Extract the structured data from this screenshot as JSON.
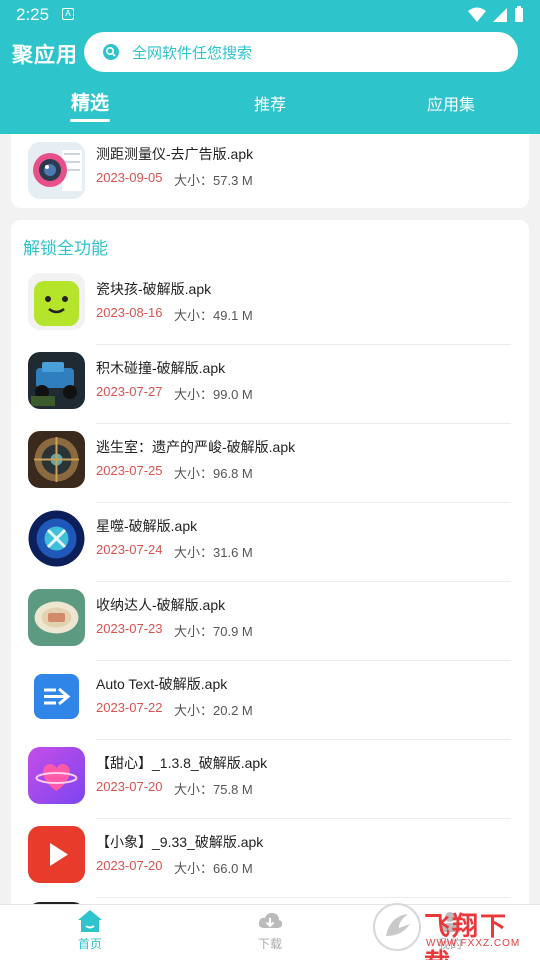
{
  "status_bar": {
    "time": "2:25",
    "sim_label": "A"
  },
  "header": {
    "app_title": "聚应用",
    "search_placeholder": "全网软件任您搜索",
    "tabs": [
      {
        "label": "精选",
        "active": true
      },
      {
        "label": "推荐",
        "active": false
      },
      {
        "label": "应用集",
        "active": false
      }
    ]
  },
  "prev_card": {
    "items": [
      {
        "name": "测距测量仪-去广告版.apk",
        "date": "2023-09-05",
        "size": "大小：57.3 M",
        "icon": "camera-lens-icon"
      }
    ]
  },
  "section": {
    "title": "解锁全功能",
    "items": [
      {
        "name": "瓷块孩-破解版.apk",
        "date": "2023-08-16",
        "size": "大小：49.1 M",
        "icon": "green-smiley-icon"
      },
      {
        "name": "积木碰撞-破解版.apk",
        "date": "2023-07-27",
        "size": "大小：99.0 M",
        "icon": "toy-car-icon"
      },
      {
        "name": "逃生室：遗产的严峻-破解版.apk",
        "date": "2023-07-25",
        "size": "大小：96.8 M",
        "icon": "vault-door-icon"
      },
      {
        "name": "星噬-破解版.apk",
        "date": "2023-07-24",
        "size": "大小：31.6 M",
        "icon": "galaxy-orb-icon"
      },
      {
        "name": "收纳达人-破解版.apk",
        "date": "2023-07-23",
        "size": "大小：70.9 M",
        "icon": "storage-plate-icon"
      },
      {
        "name": "Auto Text-破解版.apk",
        "date": "2023-07-22",
        "size": "大小：20.2 M",
        "icon": "auto-text-arrow-icon"
      },
      {
        "name": "【甜心】_1.3.8_破解版.apk",
        "date": "2023-07-20",
        "size": "大小：75.8 M",
        "icon": "heart-icon"
      },
      {
        "name": "【小象】_9.33_破解版.apk",
        "date": "2023-07-20",
        "size": "大小：66.0 M",
        "icon": "play-button-icon"
      }
    ]
  },
  "bottom_nav": {
    "items": [
      {
        "label": "首页",
        "active": true,
        "icon": "home-icon"
      },
      {
        "label": "下载",
        "active": false,
        "icon": "cloud-download-icon"
      },
      {
        "label": "我的",
        "active": false,
        "icon": "user-icon"
      }
    ]
  },
  "watermark": {
    "text": "飞翔下载",
    "url": "WWW.FXXZ.COM"
  },
  "colors": {
    "accent": "#2ec4cc",
    "date": "#d9534f",
    "background": "#f2f2f2"
  }
}
